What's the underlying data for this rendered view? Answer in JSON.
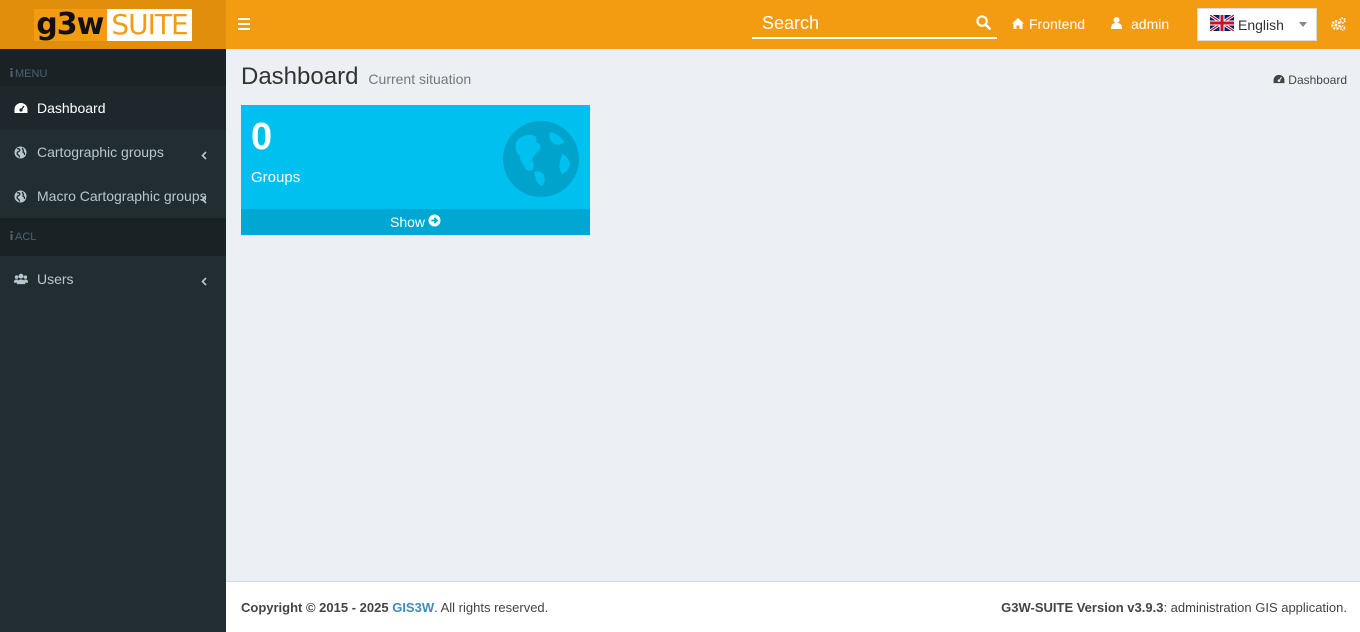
{
  "logo": {
    "part1": "g3w",
    "part2": "SUITE"
  },
  "search": {
    "placeholder": "Search"
  },
  "nav": {
    "frontend": "Frontend",
    "user": "admin"
  },
  "language": {
    "selected": "English"
  },
  "sidebar": {
    "sections": [
      {
        "header": "MENU",
        "items": [
          {
            "label": "Dashboard",
            "icon": "dashboard-icon",
            "active": true
          },
          {
            "label": "Cartographic groups",
            "icon": "globe-icon"
          },
          {
            "label": "Macro Cartographic groups",
            "icon": "globe-icon"
          }
        ]
      },
      {
        "header": "ACL",
        "items": [
          {
            "label": "Users",
            "icon": "users-icon"
          }
        ]
      }
    ]
  },
  "page": {
    "title": "Dashboard",
    "subtitle": "Current situation",
    "breadcrumb": "Dashboard"
  },
  "widgets": [
    {
      "count": "0",
      "label": "Groups",
      "footer": "Show",
      "color": "#00c0ef"
    }
  ],
  "footer": {
    "copyright": "Copyright © 2015 - 2025",
    "company": "GIS3W",
    "rights": ". All rights reserved.",
    "version_label": "G3W-SUITE Version v3.9.3",
    "version_desc": ": administration GIS application."
  },
  "colors": {
    "header": "#f39c12",
    "logo_bg": "#e08e0b",
    "sidebar": "#222d32",
    "accent": "#00c0ef"
  }
}
